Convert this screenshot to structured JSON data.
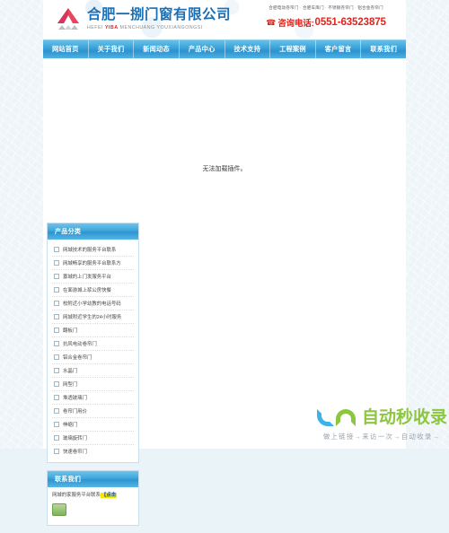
{
  "header": {
    "logo_icon": "house-roof-logo",
    "company_cn": "合肥一捌门窗有限公司",
    "company_en_pre": "HEFEI ",
    "company_en_hl": "YIBA",
    "company_en_post": " MENCHUANG YOUXIANGONGSI",
    "slogan": "合肥电动卷帘门 · 合肥车库门 · 不锈钢卷帘门 · 铝合金卷帘门",
    "phone_icon": "telephone-icon",
    "phone_label": "咨询电话:",
    "phone_number": "0551-63523875",
    "accent_blue": "#1b6fb5",
    "accent_red": "#e2231a"
  },
  "nav": {
    "items": [
      {
        "label": "网站首页"
      },
      {
        "label": "关于我们"
      },
      {
        "label": "新闻动态"
      },
      {
        "label": "产品中心"
      },
      {
        "label": "技术支持"
      },
      {
        "label": "工程案例"
      },
      {
        "label": "客户留言"
      },
      {
        "label": "联系我们"
      }
    ]
  },
  "main": {
    "plugin_message": "无法加载插件。"
  },
  "sidebar": {
    "category_panel": {
      "title": "产品分类",
      "items": [
        {
          "label": "网城技术的服务平台联系"
        },
        {
          "label": "网城畅享的服务平台联系方"
        },
        {
          "label": "寡城的上门发服务平台"
        },
        {
          "label": "在面游城上浆公房快餐"
        },
        {
          "label": "校附近小学幼教的电话号码"
        },
        {
          "label": "网城附近学生的24小时服务"
        },
        {
          "label": "翻板门"
        },
        {
          "label": "抗风电动卷帘门"
        },
        {
          "label": "铝合金卷帘门"
        },
        {
          "label": "水晶门"
        },
        {
          "label": "网型门"
        },
        {
          "label": "堆透玻璃门"
        },
        {
          "label": "卷帘门用价"
        },
        {
          "label": "伸缩门"
        },
        {
          "label": "玻璃旋转门"
        },
        {
          "label": "快速卷帘门"
        }
      ]
    },
    "contact_panel": {
      "title": "联系我们",
      "line": "网城的家服务平台联系",
      "click_label": "【点击",
      "qq_icon": "qq-chat-icon"
    }
  },
  "watermark": {
    "logo_icon": "jn-logo-icon",
    "text": "自动秒收录",
    "tagline": "做上链接→来访一次→自动收录→",
    "color_blue": "#3bb4e5",
    "color_green": "#8dc63f"
  }
}
